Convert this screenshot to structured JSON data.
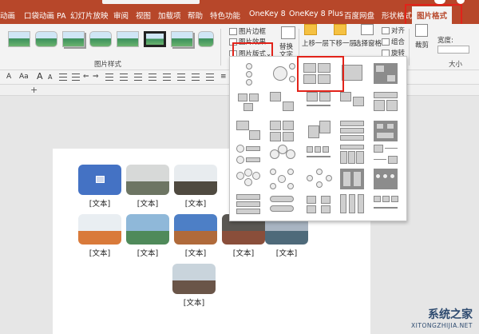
{
  "ribbon_tabs": [
    "动画",
    "口袋动画 PA",
    "幻灯片放映",
    "审阅",
    "视图",
    "加载项",
    "帮助",
    "特色功能",
    "OneKey 8",
    "OneKey 8 Plus",
    "百度网盘",
    "形状格式",
    "图片格式"
  ],
  "active_tab": "图片格式",
  "ribbon": {
    "picture_border": "图片边框",
    "picture_effects": "图片效果",
    "picture_layout": "图片版式",
    "picture_styles_group": "图片样式",
    "alt_text_line1": "替换",
    "alt_text_line2": "文字",
    "bring_forward": "上移一层",
    "send_backward": "下移一层",
    "selection_pane": "选择窗格",
    "align": "对齐",
    "group": "组合",
    "rotate": "旋转",
    "crop": "裁剪",
    "width": "宽度:",
    "size_group": "大小",
    "format_chevron": "⌄"
  },
  "format_bar": {
    "items": [
      "A",
      "Aa",
      "A",
      "A",
      "⇐",
      "⇒",
      "≡",
      "≡"
    ]
  },
  "slide": {
    "pictures": [
      {
        "label": "[文本]",
        "kind": "placeholder"
      },
      {
        "label": "[文本]",
        "kind": "foggy"
      },
      {
        "label": "[文本]",
        "kind": "mountain"
      },
      {
        "label": "[文本]",
        "kind": "autumn"
      },
      {
        "label": "[文本]",
        "kind": "lake"
      },
      {
        "label": "[文本]",
        "kind": "village"
      },
      {
        "label": "[文本]",
        "kind": "street"
      },
      {
        "label": "[文本]",
        "kind": "canal"
      },
      {
        "label": "[文本]",
        "kind": "town"
      }
    ]
  },
  "watermark": {
    "title": "系统之家",
    "subtitle": "XITONGZHIJIA.NET"
  },
  "colors": {
    "ribbon_accent": "#b7472a",
    "highlight": "#e2231a",
    "placeholder_blue": "#4472c4"
  }
}
